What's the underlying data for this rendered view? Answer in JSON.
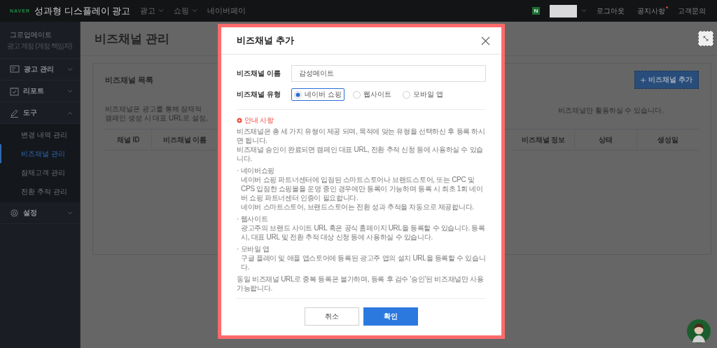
{
  "topbar": {
    "brand": "NAVER",
    "title": "성과형 디스플레이 광고",
    "nav": [
      {
        "label": "광고",
        "dropdown": true
      },
      {
        "label": "쇼핑",
        "dropdown": true
      },
      {
        "label": "네이버페이",
        "dropdown": false
      }
    ],
    "links": [
      {
        "label": "로그아웃",
        "badge": false
      },
      {
        "label": "공지사항",
        "badge": true
      },
      {
        "label": "고객문의",
        "badge": false
      }
    ]
  },
  "sidebar": {
    "account": "그로업메이트",
    "role": "광고 계정 (계정 책임자)",
    "items": [
      {
        "label": "광고 관리",
        "kind": "ads",
        "expanded": false
      },
      {
        "label": "리포트",
        "kind": "report",
        "expanded": false
      },
      {
        "label": "도구",
        "kind": "tool",
        "expanded": true,
        "children": [
          {
            "label": "변경 내역 관리",
            "selected": false
          },
          {
            "label": "비즈채널 관리",
            "selected": true
          },
          {
            "label": "잠재고객 관리",
            "selected": false
          },
          {
            "label": "전환 추적 관리",
            "selected": false
          }
        ]
      },
      {
        "label": "설정",
        "kind": "settings",
        "expanded": false
      }
    ]
  },
  "page": {
    "title": "비즈채널 관리",
    "card_title": "비즈채널 목록",
    "add_button": "비즈채널 추가",
    "description_left": [
      "비즈채널은 광고를 통해 잠재적",
      "캠페인 생성 시 대표 URL로 설정,"
    ],
    "description_right": "비즈채널만 활용하실 수 있습니다.",
    "columns_left": [
      "채널 ID",
      "비즈채널 이름"
    ],
    "columns_right": [
      "비즈채널 정보",
      "상태",
      "생성일"
    ]
  },
  "modal": {
    "title": "비즈채널 추가",
    "name_label": "비즈채널 이름",
    "name_value": "감성메이트",
    "type_label": "비즈채널 유형",
    "types": [
      {
        "label": "네이버 쇼핑",
        "selected": true
      },
      {
        "label": "웹사이트",
        "selected": false
      },
      {
        "label": "모바일 앱",
        "selected": false
      }
    ],
    "notice": {
      "title": "안내 사항",
      "intro": [
        "비즈채널은 총 세 가지 유형이 제공 되며, 목적에 맞는 유형을 선택하신 후 등록 하시면 됩니다.",
        "비즈채널 승인이 완료되면 캠페인 대표 URL, 전환 추적 신청 등에 사용하실 수 있습니다."
      ],
      "sections": [
        {
          "title": "· 네이버쇼핑",
          "paragraphs": [
            "네이버 쇼핑 파트너센터에 입점된 스마트스토어나 브랜드스토어, 또는 CPC 및 CPS 입점한 쇼핑몰을 운영 중인 경우에만 등록이 가능하며 등록 시 최초 1회 네이버 쇼핑 파트너센터 인증이 필요합니다.",
            "네이버 스마트스토어, 브랜드스토어는 전환 성과 추적을 자동으로 제공합니다."
          ]
        },
        {
          "title": "· 웹사이트",
          "paragraphs": [
            "광고주의 브랜드 사이트 URL 혹은 공식 홈페이지 URL을 등록할 수 있습니다. 등록 시, 대표 URL 및 전환 추적 대상 신청 등에 사용하실 수 있습니다."
          ]
        },
        {
          "title": "· 모바일 앱",
          "paragraphs": [
            "구글 플레이 및 애플 앱스토어에 등록된 광고주 앱의 설치 URL을 등록할 수 있습니다."
          ]
        }
      ],
      "footer": "동일 비즈채널 URL로 중복 등록은 불가하며, 등록 후 검수 '승인'된 비즈채널만 사용 가능합니다."
    },
    "cancel": "취소",
    "confirm": "확인"
  }
}
